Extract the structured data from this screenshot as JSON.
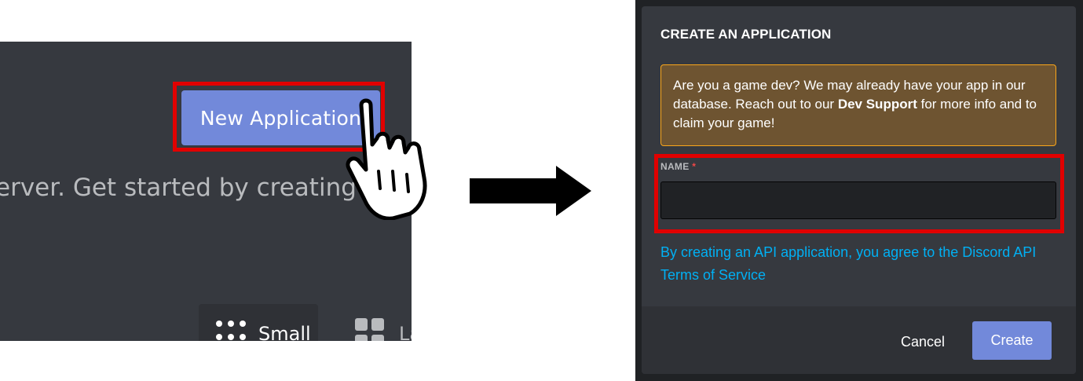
{
  "left_panel": {
    "new_application_button": "New Application",
    "description_fragment": "erver. Get started by creating a",
    "view_size": {
      "small_label": "Small",
      "large_label": "La"
    }
  },
  "modal": {
    "title": "CREATE AN APPLICATION",
    "notice": {
      "text_before": "Are you a game dev? We may already have your app in our database. Reach out to our ",
      "link_text": "Dev Support",
      "text_after": " for more info and to claim your game!"
    },
    "name_field": {
      "label": "NAME",
      "required_marker": "*",
      "value": ""
    },
    "tos_text": "By creating an API application, you agree to the Discord API Terms of Service",
    "footer": {
      "cancel_label": "Cancel",
      "create_label": "Create"
    }
  },
  "colors": {
    "blurple": "#7289da",
    "highlight_red": "#e10000",
    "warning_border": "#faa61a",
    "link_blue": "#00b0f4",
    "panel_bg": "#36393f"
  },
  "icons": {
    "pointer": "hand-pointer-icon",
    "transition": "right-arrow-icon",
    "small_view": "grid-dots-icon",
    "large_view": "grid-large-icon"
  }
}
